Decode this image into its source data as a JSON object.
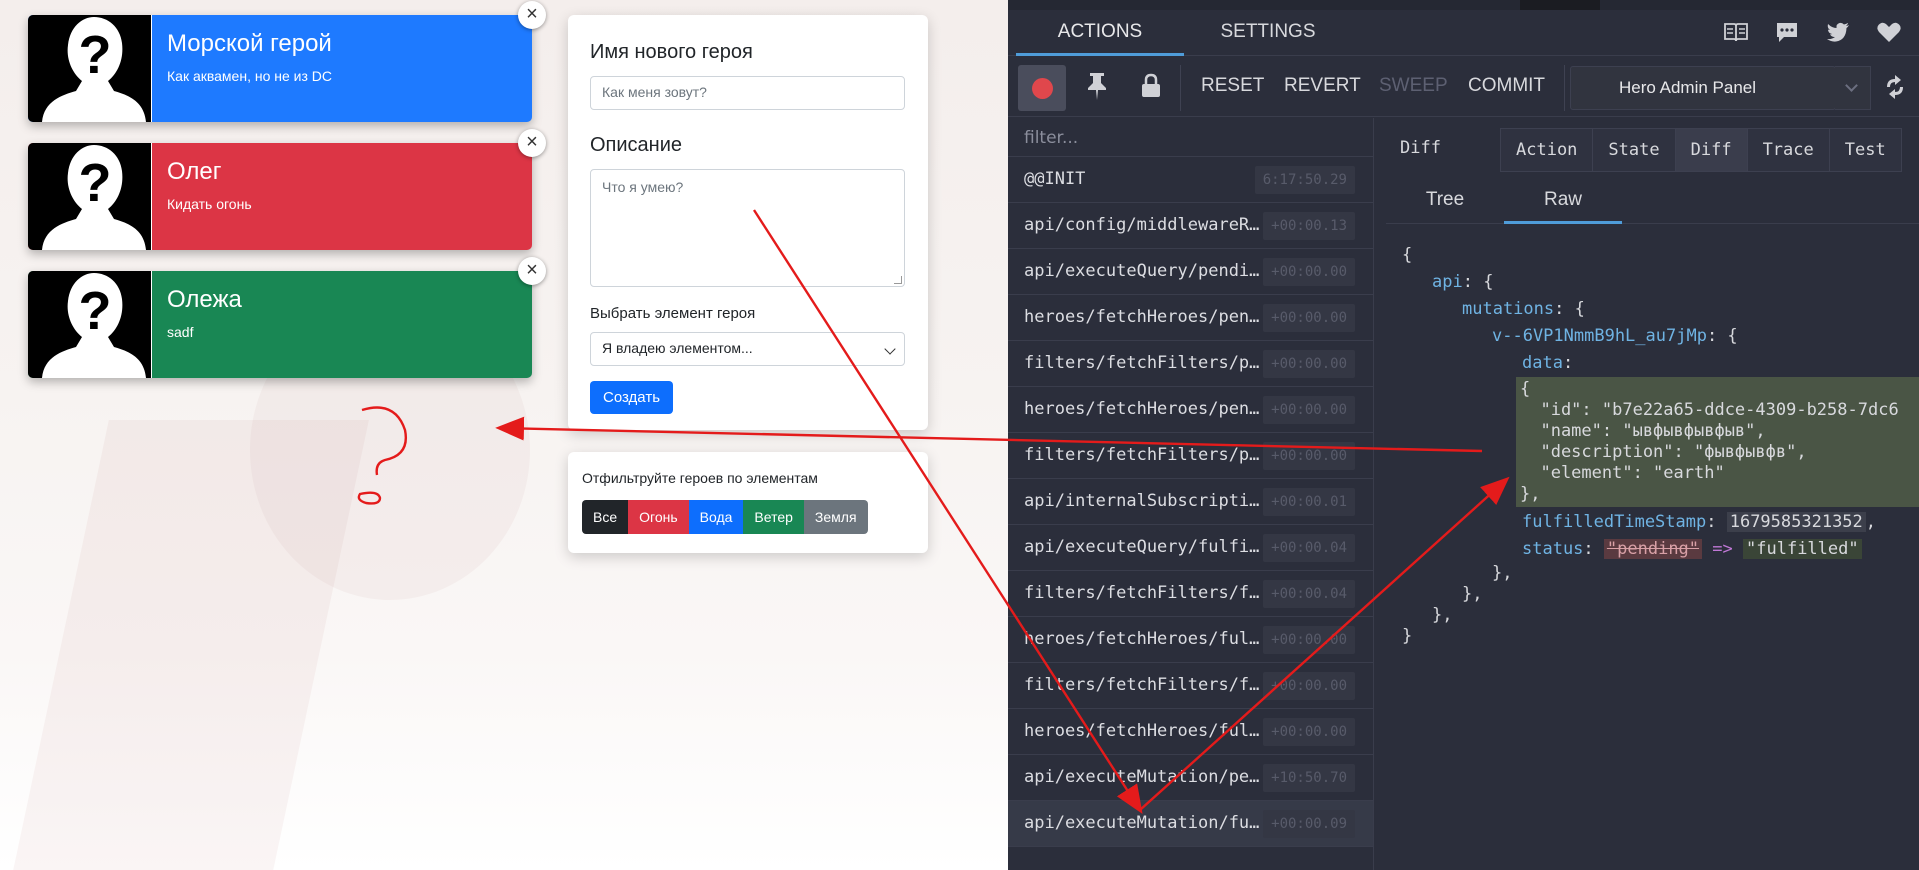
{
  "heroes": [
    {
      "name": "Морской герой",
      "description": "Как аквамен, но не из DC",
      "element_color": "#1e7aff",
      "close": "×"
    },
    {
      "name": "Олег",
      "description": "Кидать огонь",
      "element_color": "#dc3545",
      "close": "×"
    },
    {
      "name": "Олежа",
      "description": "sadf",
      "element_color": "#198754",
      "close": "×"
    }
  ],
  "form": {
    "name_label": "Имя нового героя",
    "name_placeholder": "Как меня зовут?",
    "description_label": "Описание",
    "description_placeholder": "Что я умею?",
    "element_label": "Выбрать элемент героя",
    "element_selected": "Я владею элементом...",
    "submit_label": "Создать"
  },
  "filters": {
    "title": "Отфильтруйте героев по элементам",
    "buttons": [
      {
        "label": "Все",
        "color": "#212529"
      },
      {
        "label": "Огонь",
        "color": "#dc3545"
      },
      {
        "label": "Вода",
        "color": "#0d6efd"
      },
      {
        "label": "Ветер",
        "color": "#198754"
      },
      {
        "label": "Земля",
        "color": "#6c757d"
      }
    ]
  },
  "devtools": {
    "tabs": [
      "ACTIONS",
      "SETTINGS"
    ],
    "header_icons": [
      "docs-icon",
      "chat-icon",
      "twitter-icon",
      "heart-icon"
    ],
    "toolbar": {
      "reset": "RESET",
      "revert": "REVERT",
      "sweep": "SWEEP",
      "commit": "COMMIT",
      "instance": "Hero Admin Panel"
    },
    "filter_placeholder": "filter...",
    "actions": [
      {
        "name": "@@INIT",
        "time": "6:17:50.29"
      },
      {
        "name": "api/config/middlewareRegistered",
        "time": "+00:00.13"
      },
      {
        "name": "api/executeQuery/pending",
        "time": "+00:00.00"
      },
      {
        "name": "heroes/fetchHeroes/pending",
        "time": "+00:00.00"
      },
      {
        "name": "filters/fetchFilters/pending",
        "time": "+00:00.00"
      },
      {
        "name": "heroes/fetchHeroes/pending",
        "time": "+00:00.00"
      },
      {
        "name": "filters/fetchFilters/pending",
        "time": "+00:00.00"
      },
      {
        "name": "api/internalSubscriptions",
        "time": "+00:00.01"
      },
      {
        "name": "api/executeQuery/fulfilled",
        "time": "+00:00.04"
      },
      {
        "name": "filters/fetchFilters/fulfilled",
        "time": "+00:00.04"
      },
      {
        "name": "heroes/fetchHeroes/fulfilled",
        "time": "+00:00.00"
      },
      {
        "name": "filters/fetchFilters/fulfilled",
        "time": "+00:00.00"
      },
      {
        "name": "heroes/fetchHeroes/fulfilled",
        "time": "+00:00.00"
      },
      {
        "name": "api/executeMutation/pending",
        "time": "+10:50.70"
      },
      {
        "name": "api/executeMutation/fulfilled",
        "time": "+00:00.09"
      }
    ],
    "diff_label": "Diff",
    "modes": [
      "Action",
      "State",
      "Diff",
      "Trace",
      "Test"
    ],
    "subtabs": [
      "Tree",
      "Raw"
    ],
    "code": {
      "open": "{",
      "api_key": "api",
      "mutations_key": "mutations",
      "mutation_id": "v--6VP1NmmB9hL_au7jMp",
      "data_key": "data",
      "data_lines": [
        "{",
        "  \"id\": \"b7e22a65-ddce-4309-b258-7dc6",
        "  \"name\": \"ывфывфывфыв\",",
        "  \"description\": \"фывфывфв\",",
        "  \"element\": \"earth\"",
        "},"
      ],
      "ts_key": "fulfilledTimeStamp",
      "ts_value": "1679585321352",
      "status_key": "status",
      "status_old": "\"pending\"",
      "status_arrow": "=>",
      "status_new": "\"fulfilled\"",
      "close_inner": "},",
      "close_mid": "},",
      "close_outer": "},",
      "close_root": "}"
    }
  },
  "annotation": {
    "question": "?"
  }
}
